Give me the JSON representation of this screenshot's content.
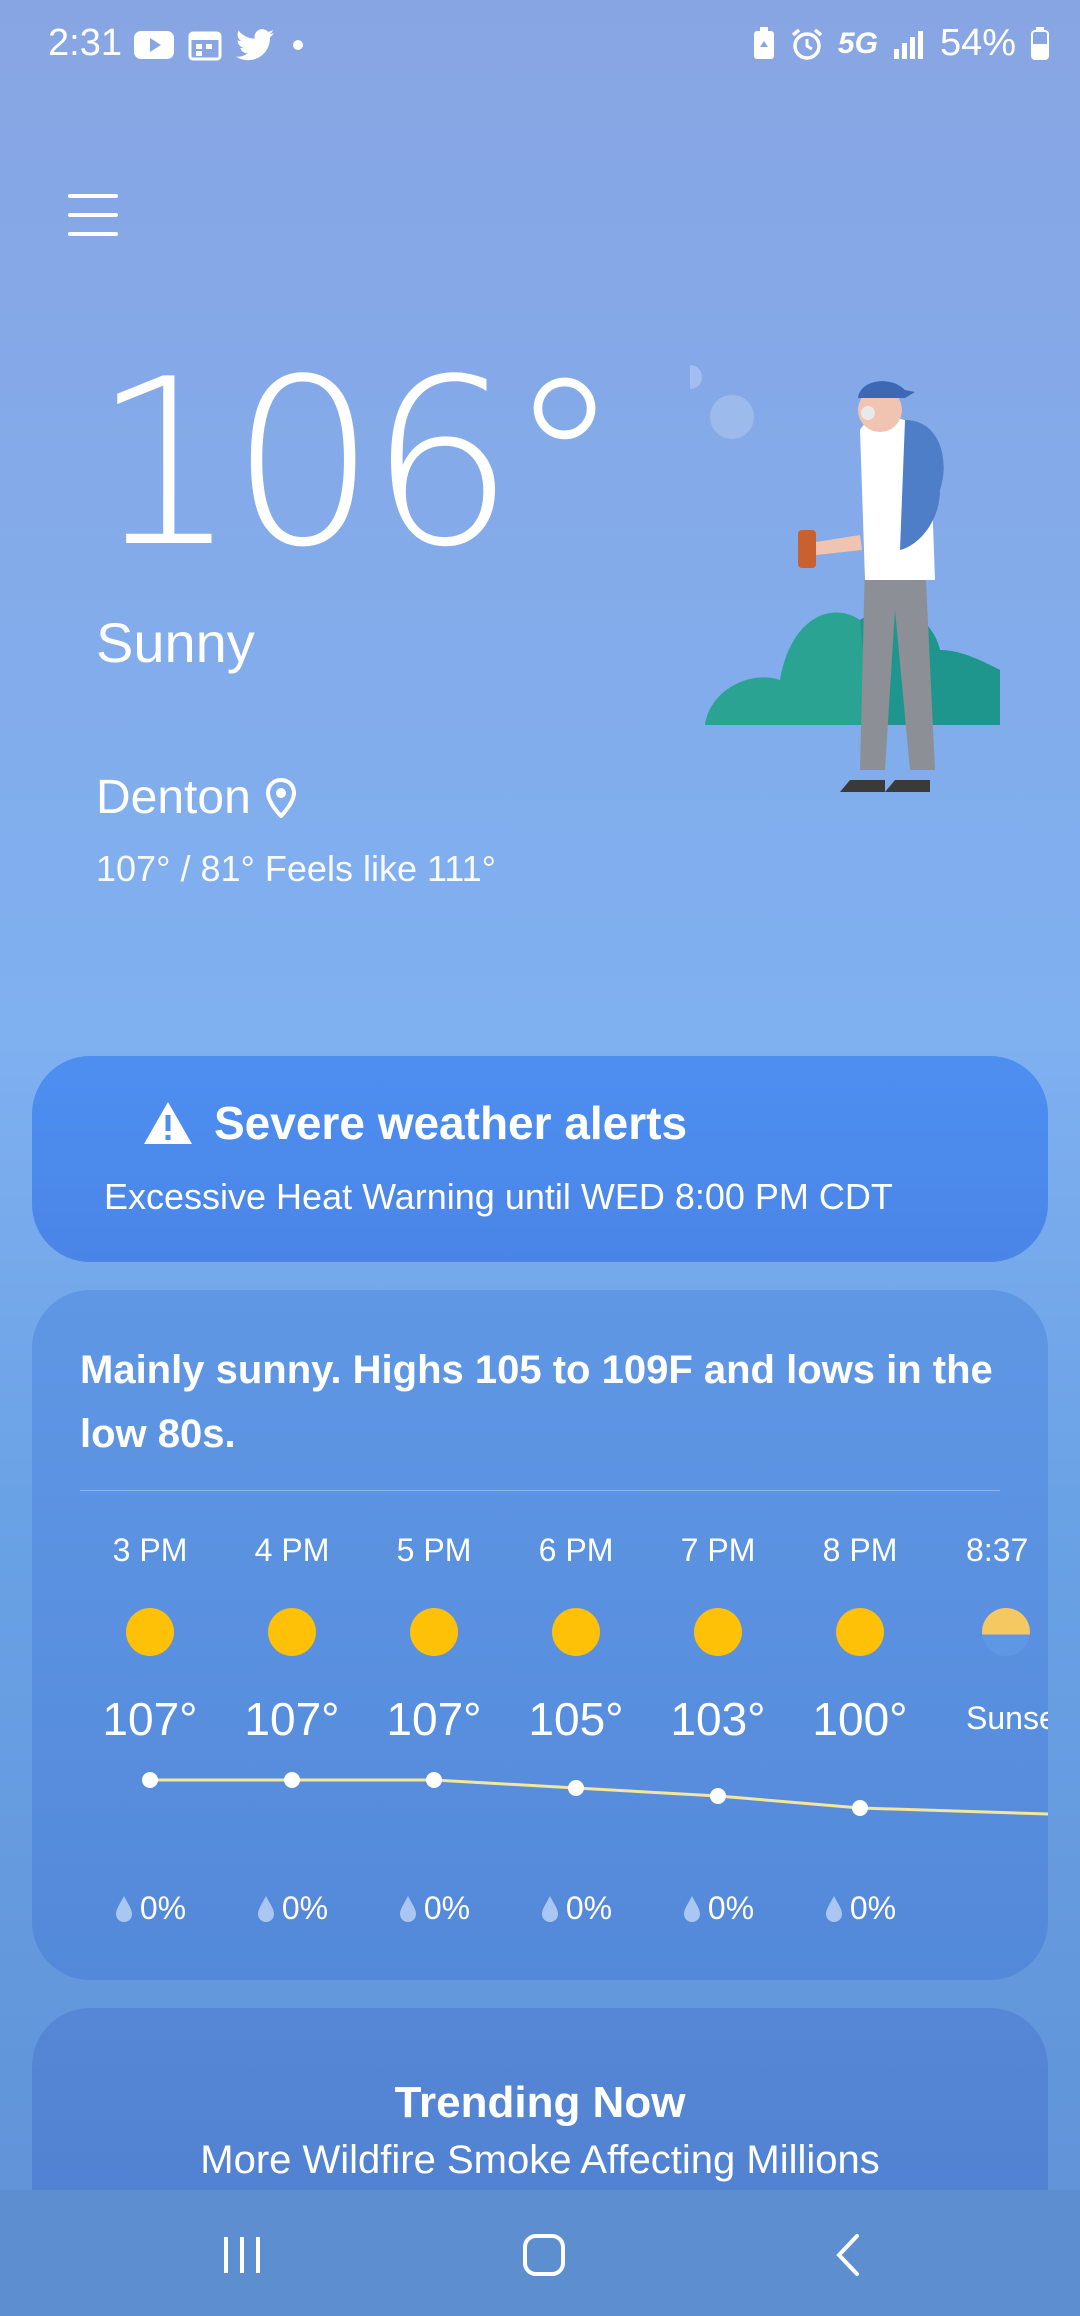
{
  "status_bar": {
    "time": "2:31",
    "network": "5G",
    "battery": "54%",
    "left_icons": [
      "youtube-icon",
      "calendar-icon",
      "twitter-icon",
      "dot-icon"
    ],
    "right_icons": [
      "battery-saver-icon",
      "alarm-icon",
      "5g-icon",
      "signal-icon",
      "battery-icon"
    ]
  },
  "current": {
    "temperature": "106°",
    "condition": "Sunny",
    "location": "Denton",
    "hilo_feels": "107° / 81° Feels like 111°"
  },
  "alert": {
    "title": "Severe weather alerts",
    "description": "Excessive Heat Warning until WED 8:00 PM CDT"
  },
  "forecast": {
    "summary": "Mainly sunny. Highs 105 to 109F and lows in the low 80s.",
    "hours": [
      {
        "time": "3 PM",
        "temp": "107°",
        "precip": "0%",
        "value": 107
      },
      {
        "time": "4 PM",
        "temp": "107°",
        "precip": "0%",
        "value": 107
      },
      {
        "time": "5 PM",
        "temp": "107°",
        "precip": "0%",
        "value": 107
      },
      {
        "time": "6 PM",
        "temp": "105°",
        "precip": "0%",
        "value": 105
      },
      {
        "time": "7 PM",
        "temp": "103°",
        "precip": "0%",
        "value": 103
      },
      {
        "time": "8 PM",
        "temp": "100°",
        "precip": "0%",
        "value": 100
      }
    ],
    "sunset": {
      "time": "8:37",
      "label": "Sunset"
    }
  },
  "trending": {
    "title": "Trending Now",
    "headline": "More Wildfire Smoke Affecting Millions"
  },
  "nav": {
    "items": [
      "recents-button",
      "home-button",
      "back-button"
    ]
  },
  "colors": {
    "sun": "#ffc107",
    "graph_line": "#f5e79a"
  }
}
